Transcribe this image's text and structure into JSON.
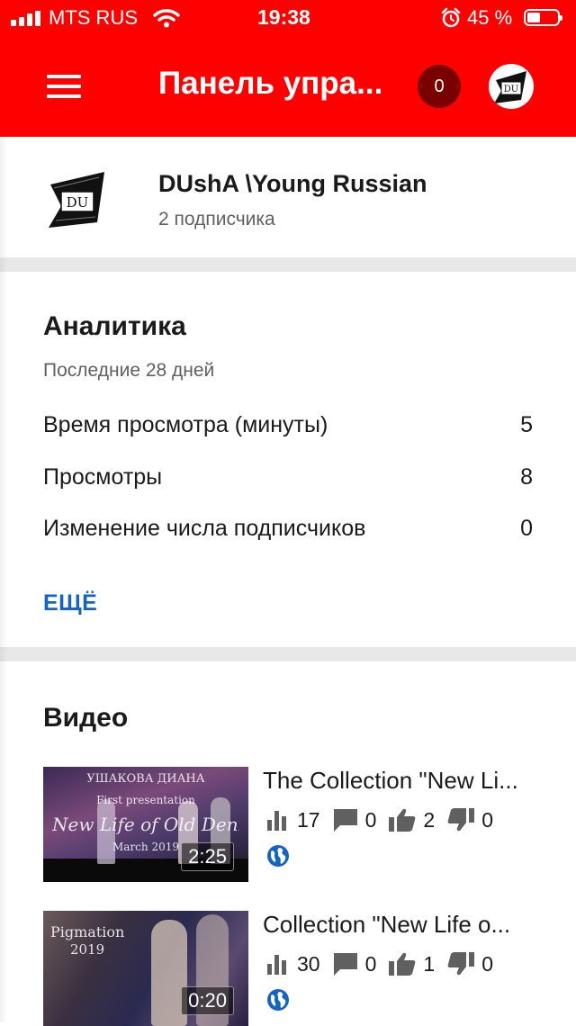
{
  "status_bar": {
    "carrier": "MTS RUS",
    "time": "19:38",
    "battery_percent": "45 %",
    "battery_level": 0.45,
    "icons": [
      "signal-icon",
      "wifi-icon",
      "alarm-icon",
      "battery-icon"
    ]
  },
  "app_bar": {
    "title": "Панель упра...",
    "notification_count": "0",
    "icons": [
      "menu-icon",
      "avatar"
    ]
  },
  "channel": {
    "name": "DUshA \\Young Russian",
    "subscribers": "2 подписчика",
    "logo_text": "DU"
  },
  "analytics": {
    "title": "Аналитика",
    "period": "Последние 28 дней",
    "metrics": [
      {
        "label": "Время просмотра (минуты)",
        "value": "5"
      },
      {
        "label": "Просмотры",
        "value": "8"
      },
      {
        "label": "Изменение числа подписчиков",
        "value": "0"
      }
    ],
    "more_label": "ЕЩЁ"
  },
  "videos": {
    "title": "Видео",
    "items": [
      {
        "title": "The Collection \"New Li...",
        "duration": "2:25",
        "views": "17",
        "comments": "0",
        "likes": "2",
        "dislikes": "0",
        "thumb_lines": [
          "УШАКОВА ДИАНА",
          "First presentation",
          "New Life of Old Denim",
          "March 2019"
        ]
      },
      {
        "title": "Collection \"New Life o...",
        "duration": "0:20",
        "views": "30",
        "comments": "0",
        "likes": "1",
        "dislikes": "0",
        "thumb_lines": [
          "Pigmation",
          "2019"
        ]
      }
    ]
  },
  "colors": {
    "brand_red": "#ff0000",
    "badge_dark_red": "#7a0000",
    "link_blue": "#1565c0",
    "icon_gray": "#606060",
    "globe_blue": "#1565c0"
  }
}
